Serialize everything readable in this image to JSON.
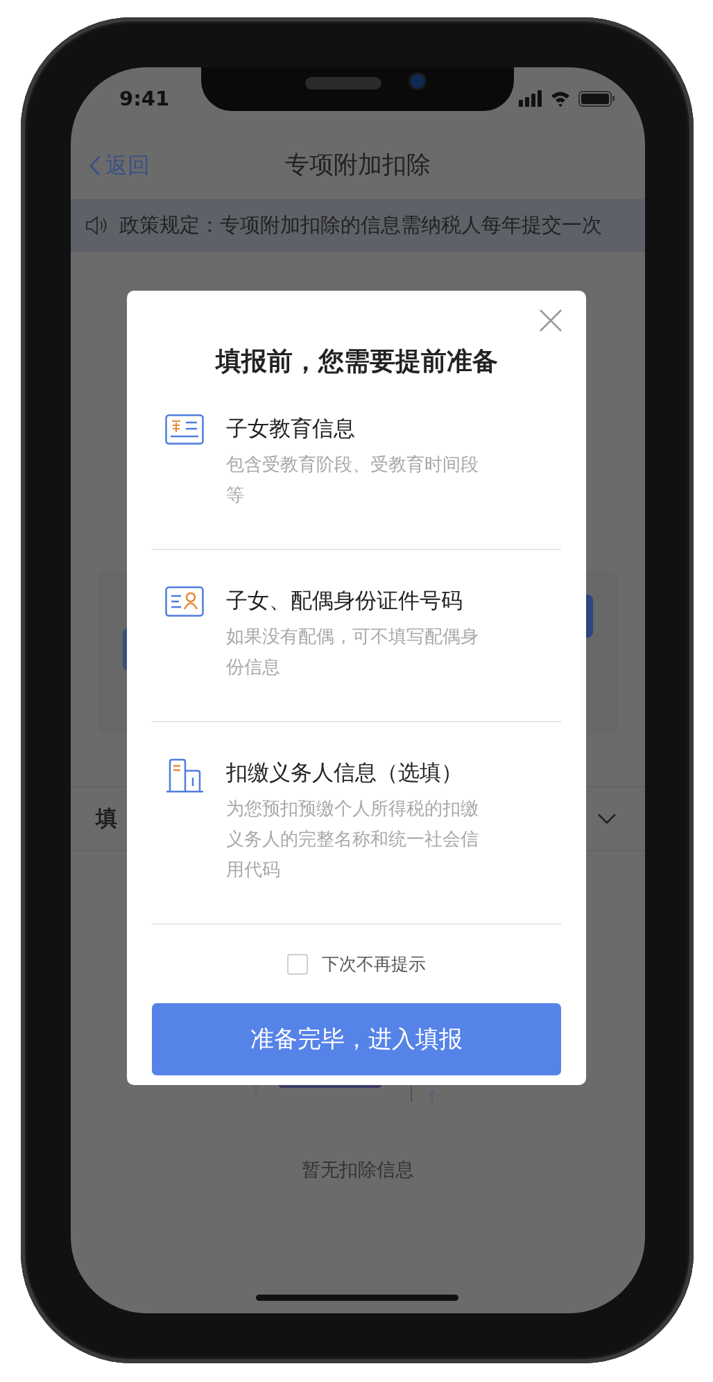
{
  "status_bar": {
    "time": "9:41"
  },
  "nav": {
    "back": "返回",
    "title": "专项附加扣除"
  },
  "notice": {
    "text": "政策规定：专项附加扣除的信息需纳税人每年提交一次"
  },
  "background": {
    "section_title": "填",
    "empty_text": "暂无扣除信息"
  },
  "dialog": {
    "title": "填报前，您需要提前准备",
    "items": [
      {
        "kind": "education",
        "title": "子女教育信息",
        "description": "包含受教育阶段、受教育时间段等"
      },
      {
        "kind": "id_card",
        "title": "子女、配偶身份证件号码",
        "description": "如果没有配偶，可不填写配偶身份信息"
      },
      {
        "kind": "company",
        "title": "扣缴义务人信息（选填）",
        "description": "为您预扣预缴个人所得税的扣缴义务人的完整名称和统一社会信用代码"
      }
    ],
    "dont_show_again": {
      "label": "下次不再提示",
      "checked": false
    },
    "confirm_button": "准备完毕，进入填报"
  }
}
